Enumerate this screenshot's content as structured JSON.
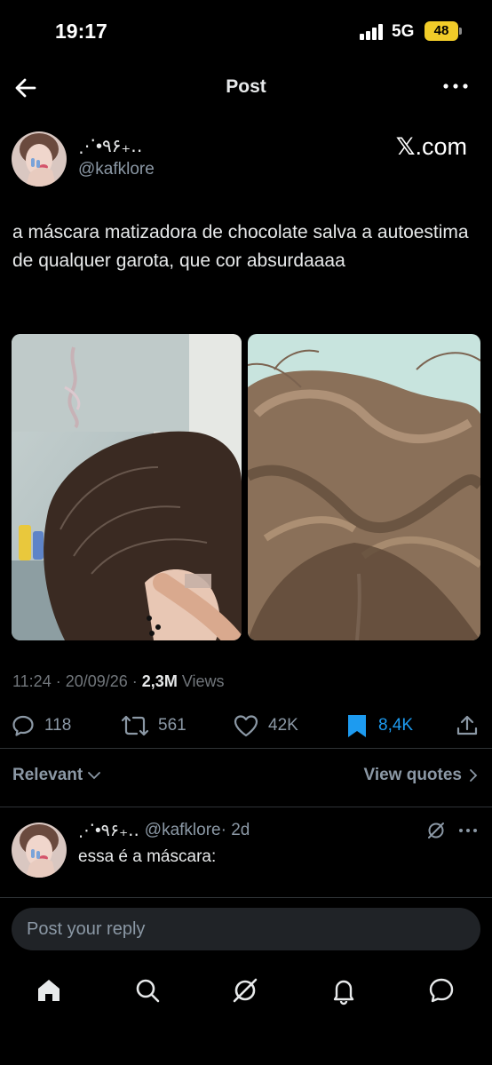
{
  "status_bar": {
    "time": "19:17",
    "network": "5G",
    "battery": "48"
  },
  "nav": {
    "title": "Post"
  },
  "author": {
    "display_name": "⋰•٩۶₊‥",
    "handle": "@kafklore",
    "source_badge_main": "𝕏",
    "source_badge_rest": ".com"
  },
  "post": {
    "text": "a máscara matizadora de chocolate salva a autoestima de qualquer garota, que cor absurdaaaa",
    "time": "11:24",
    "date": "20/09/26",
    "views_count": "2,3M",
    "views_label": "Views"
  },
  "actions": {
    "replies": "118",
    "reposts": "561",
    "likes": "42K",
    "bookmarks": "8,4K"
  },
  "replies_header": {
    "sort_label": "Relevant",
    "view_quotes_label": "View quotes"
  },
  "reply": {
    "display_name": "⋰•٩۶₊‥",
    "handle": "@kafklore",
    "age": "· 2d",
    "text": "essa é a máscara:"
  },
  "composer": {
    "placeholder": "Post your reply"
  },
  "colors": {
    "background": "#000000",
    "text": "#e7e9ea",
    "muted": "#8b98a5",
    "accent": "#1d9bf0",
    "battery": "#f1cc29"
  },
  "icons": [
    "back-arrow-icon",
    "more-icon",
    "reply-icon",
    "repost-icon",
    "like-icon",
    "bookmark-icon",
    "share-icon",
    "chevron-down-icon",
    "chevron-right-icon",
    "grok-icon",
    "home-icon",
    "search-icon",
    "notifications-icon",
    "messages-icon"
  ]
}
